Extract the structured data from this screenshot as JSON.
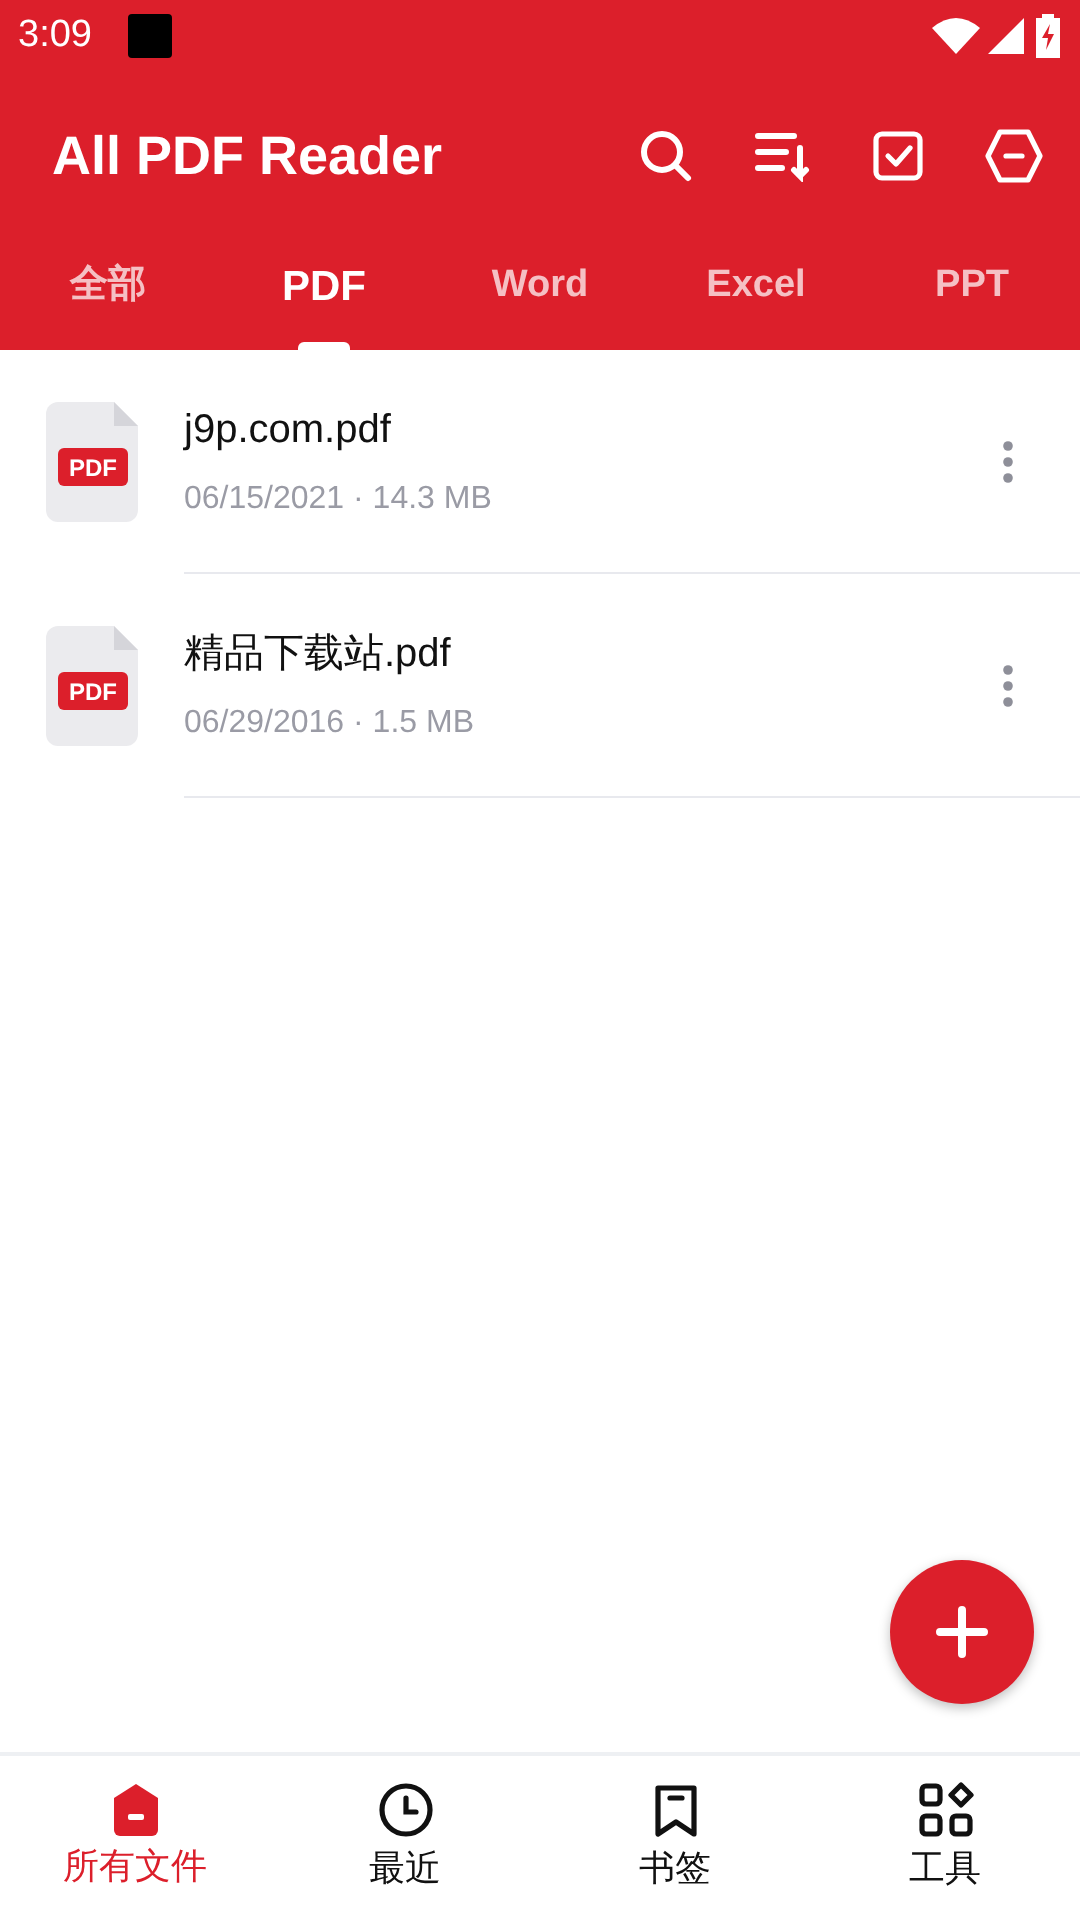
{
  "status_bar": {
    "time": "3:09"
  },
  "app_bar": {
    "title": "All PDF Reader"
  },
  "tabs": [
    {
      "label": "全部",
      "selected": false
    },
    {
      "label": "PDF",
      "selected": true
    },
    {
      "label": "Word",
      "selected": false
    },
    {
      "label": "Excel",
      "selected": false
    },
    {
      "label": "PPT",
      "selected": false
    }
  ],
  "files": [
    {
      "name": "j9p.com.pdf",
      "type_label": "PDF",
      "meta": "06/15/2021 · 14.3 MB"
    },
    {
      "name": "精品下载站.pdf",
      "type_label": "PDF",
      "meta": "06/29/2016 · 1.5 MB"
    }
  ],
  "bottom_nav": [
    {
      "label": "所有文件",
      "selected": true
    },
    {
      "label": "最近",
      "selected": false
    },
    {
      "label": "书签",
      "selected": false
    },
    {
      "label": "工具",
      "selected": false
    }
  ]
}
